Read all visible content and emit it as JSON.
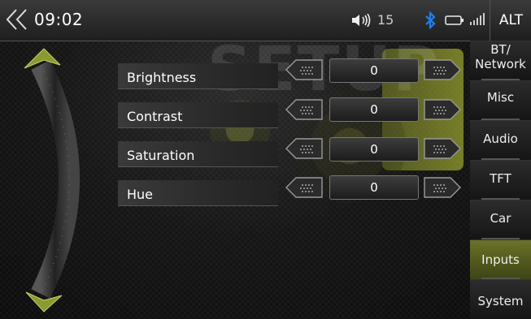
{
  "status_bar": {
    "time": "09:02",
    "volume": "15",
    "back_icon": "double-chevron-left-icon",
    "volume_icon": "speaker-icon",
    "bluetooth_icon": "bluetooth-icon",
    "battery_icon": "battery-icon",
    "signal_icon": "signal-bars-icon",
    "alt_label": "ALT"
  },
  "watermark": "SETUP",
  "settings": [
    {
      "label": "Brightness",
      "value": "0"
    },
    {
      "label": "Contrast",
      "value": "0"
    },
    {
      "label": "Saturation",
      "value": "0"
    },
    {
      "label": "Hue",
      "value": "0"
    }
  ],
  "sidebar": {
    "items": [
      {
        "label_line1": "BT/",
        "label_line2": "Network"
      },
      {
        "label": "Misc"
      },
      {
        "label": "Audio"
      },
      {
        "label": "TFT"
      },
      {
        "label": "Car"
      },
      {
        "label": "Inputs"
      },
      {
        "label": "System"
      }
    ],
    "active": "Inputs"
  },
  "colors": {
    "accent": "#7a8a2a",
    "bluetooth": "#1e7ff0"
  }
}
